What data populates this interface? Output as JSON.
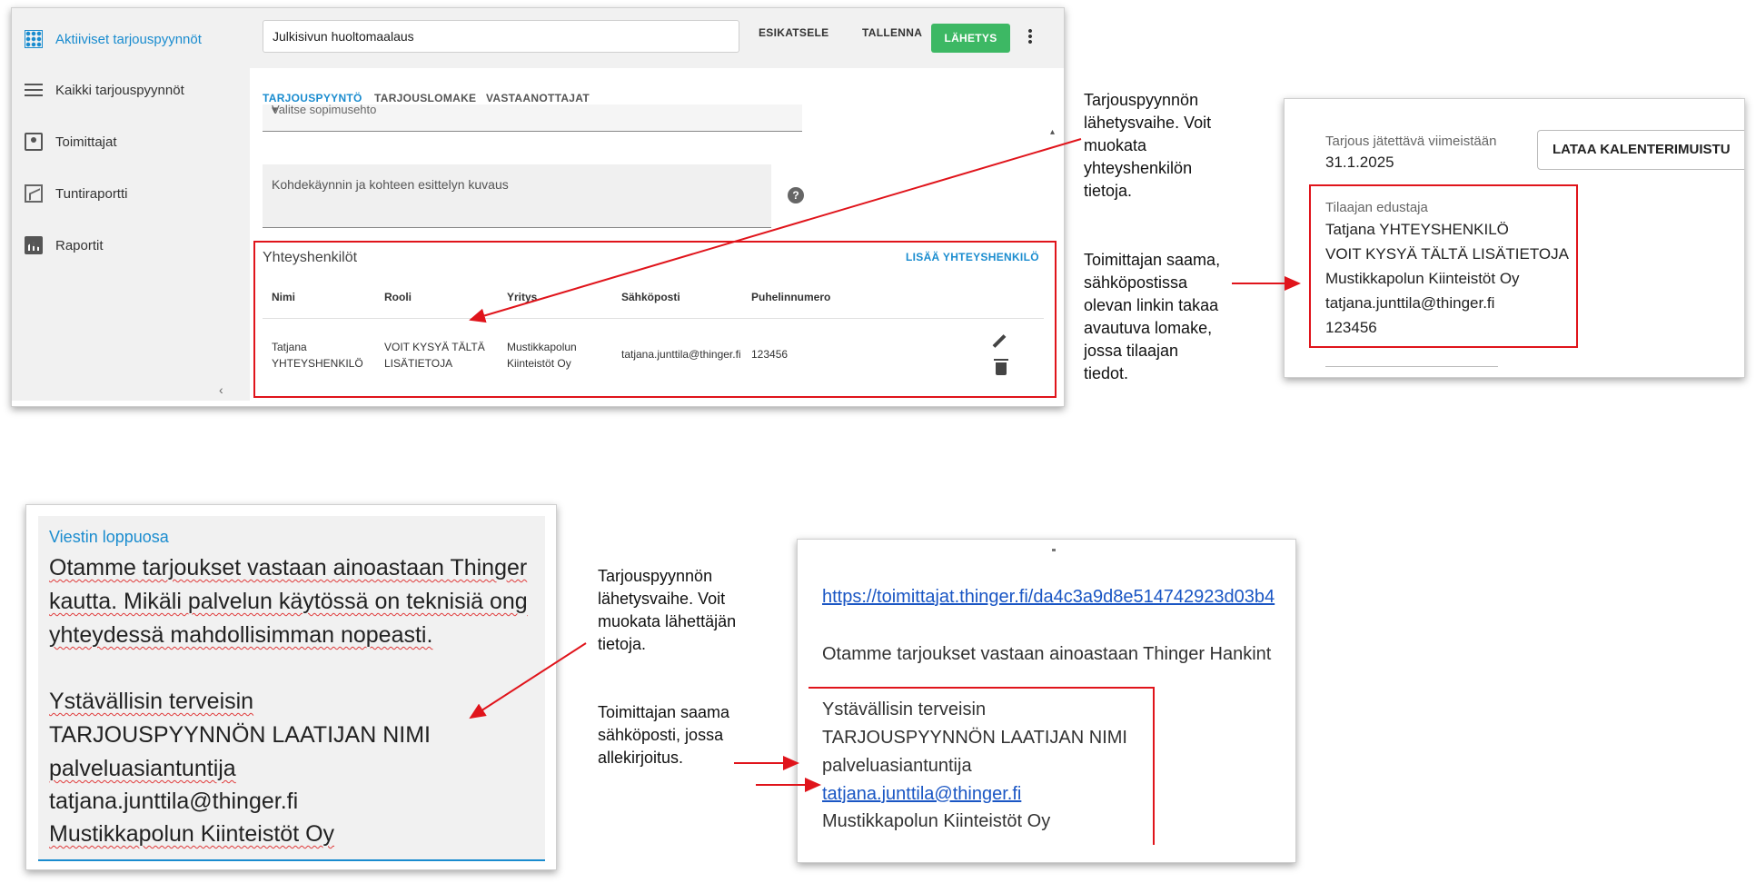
{
  "app": {
    "sidebar": {
      "items": [
        {
          "label": "Aktiiviset tarjouspyynnöt",
          "icon": "grid-icon",
          "active": true
        },
        {
          "label": "Kaikki tarjouspyynnöt",
          "icon": "list-icon"
        },
        {
          "label": "Toimittajat",
          "icon": "contact-card-icon"
        },
        {
          "label": "Tuntiraportti",
          "icon": "chart-report-icon"
        },
        {
          "label": "Raportit",
          "icon": "bar-chart-icon"
        }
      ]
    },
    "topbar": {
      "title_value": "Julkisivun huoltomaalaus",
      "preview_label": "ESIKATSELE",
      "save_label": "TALLENNA",
      "send_label": "LÄHETYS"
    },
    "tabs": [
      {
        "label": "TARJOUSPYYNTÖ",
        "active": true
      },
      {
        "label": "TARJOUSLOMAKE"
      },
      {
        "label": "VASTAANOTTAJAT"
      }
    ],
    "contract_select_placeholder": "Valitse sopimusehto",
    "description_placeholder": "Kohdekäynnin ja kohteen esittelyn kuvaus",
    "contacts": {
      "title": "Yhteyshenkilöt",
      "add_label": "LISÄÄ YHTEYSHENKILÖ",
      "headers": {
        "name": "Nimi",
        "role": "Rooli",
        "company": "Yritys",
        "email": "Sähköposti",
        "phone": "Puhelinnumero"
      },
      "row": {
        "name_line1": "Tatjana",
        "name_line2": "YHTEYSHENKILÖ",
        "role_line1": "VOIT KYSYÄ TÄLTÄ",
        "role_line2": "LISÄTIETOJA",
        "company_line1": "Mustikkapolun",
        "company_line2": "Kiinteistöt Oy",
        "email": "tatjana.junttila@thinger.fi",
        "phone": "123456"
      }
    }
  },
  "notes": {
    "note1": [
      "Tarjouspyynnön",
      "lähetysvaihe. Voit",
      "muokata",
      "yhteyshenkilön",
      "tietoja."
    ],
    "note2": [
      "Toimittajan saama,",
      "sähköpostissa",
      "olevan linkin takaa",
      "avautuva lomake,",
      "jossa tilaajan",
      "tiedot."
    ],
    "note3": [
      "Tarjouspyynnön",
      "lähetysvaihe. Voit",
      "muokata lähettäjän",
      "tietoja."
    ],
    "note4": [
      "Toimittajan saama",
      "sähköposti, jossa",
      "allekirjoitus."
    ]
  },
  "supplier_form": {
    "deadline_label": "Tarjous jätettävä viimeistään",
    "deadline_value": "31.1.2025",
    "calendar_button": "LATAA KALENTERIMUISTU",
    "rep_label": "Tilaajan edustaja",
    "rep_lines": [
      "Tatjana YHTEYSHENKILÖ",
      "VOIT KYSYÄ TÄLTÄ LISÄTIETOJA",
      "Mustikkapolun Kiinteistöt Oy",
      "tatjana.junttila@thinger.fi",
      "123456"
    ]
  },
  "message_end": {
    "label": "Viestin loppuosa",
    "body_lines": [
      "Otamme tarjoukset vastaan ainoastaan Thinger",
      "kautta. Mikäli palvelun käytössä on teknisiä ong",
      "yhteydessä mahdollisimman nopeasti."
    ],
    "signature_lines": [
      "Ystävällisin terveisin",
      "TARJOUSPYYNNÖN LAATIJAN NIMI",
      "palveluasiantuntija",
      "tatjana.junttila@thinger.fi",
      "Mustikkapolun Kiinteistöt Oy"
    ]
  },
  "email_preview": {
    "link": "https://toimittajat.thinger.fi/da4c3a9d8e514742923d03b4",
    "intro": "Otamme tarjoukset vastaan ainoastaan Thinger Hankint",
    "signature_lines": [
      "Ystävällisin terveisin",
      "TARJOUSPYYNNÖN LAATIJAN NIMI",
      "palveluasiantuntija",
      "tatjana.junttila@thinger.fi",
      "Mustikkapolun Kiinteistöt Oy"
    ]
  },
  "colors": {
    "accent": "#1a8ccf",
    "send_button": "#3db864",
    "highlight": "#e0141b"
  }
}
